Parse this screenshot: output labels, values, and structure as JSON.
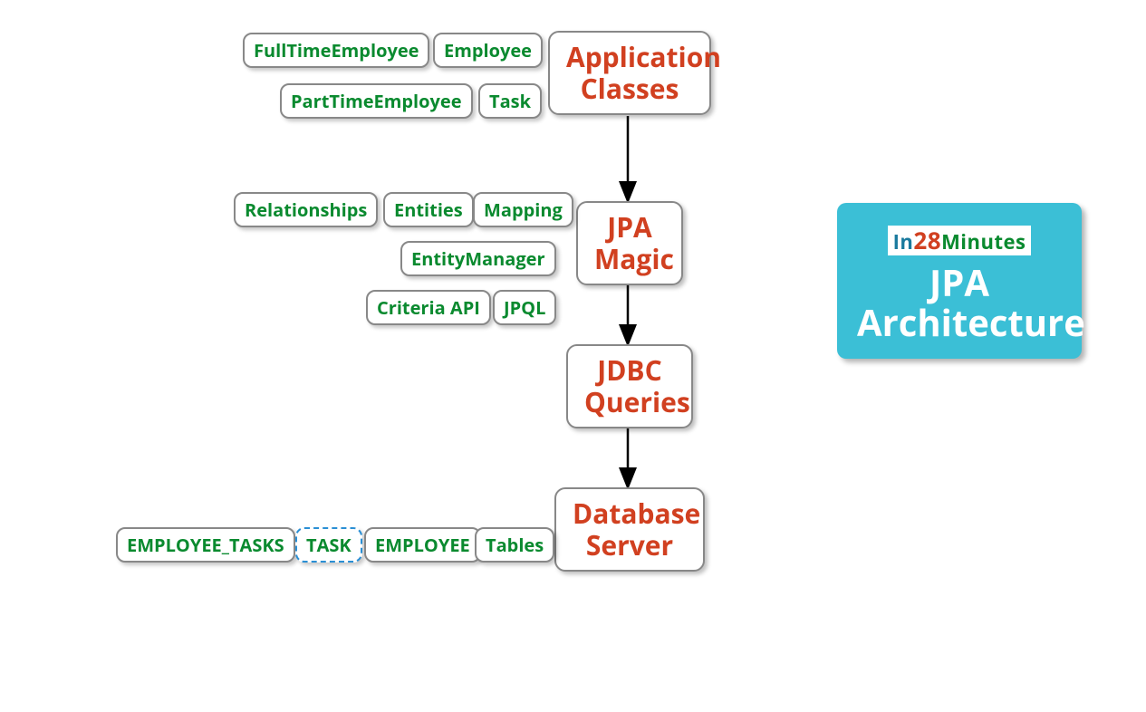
{
  "main_nodes": {
    "app_classes": {
      "line1": "Application",
      "line2": "Classes"
    },
    "jpa_magic": {
      "line1": "JPA",
      "line2": "Magic"
    },
    "jdbc_queries": {
      "line1": "JDBC",
      "line2": "Queries"
    },
    "db_server": {
      "line1": "Database",
      "line2": "Server"
    }
  },
  "leaves": {
    "full_time_employee": "FullTimeEmployee",
    "employee": "Employee",
    "part_time_employee": "PartTimeEmployee",
    "task": "Task",
    "relationships": "Relationships",
    "entities": "Entities",
    "mapping": "Mapping",
    "entity_manager": "EntityManager",
    "criteria_api": "Criteria API",
    "jpql": "JPQL",
    "employee_tasks_tbl": "EMPLOYEE_TASKS",
    "task_tbl": "TASK",
    "employee_tbl": "EMPLOYEE",
    "tables": "Tables"
  },
  "title_card": {
    "logo_in": "In",
    "logo_28": "28",
    "logo_min": "Minutes",
    "line1": "JPA",
    "line2": "Architecture"
  }
}
